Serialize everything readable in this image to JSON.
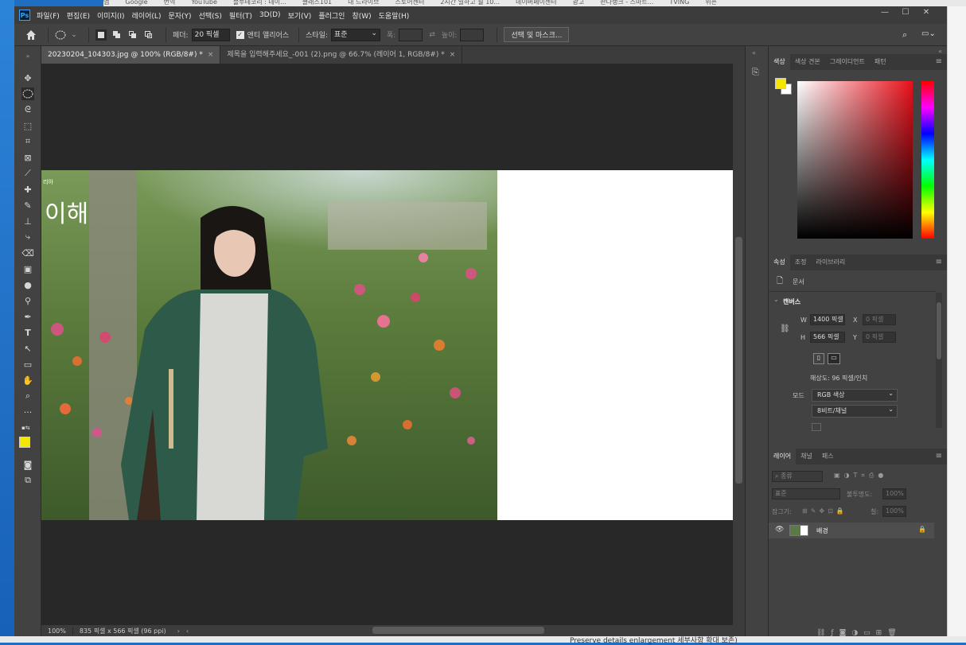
{
  "bookmarks": [
    "앱",
    "Google",
    "번역",
    "YouTube",
    "블루테코리 : 네이...",
    "클래스101",
    "내 드라이브",
    "스토어센터",
    "2시간 일하고 월 10...",
    "네이버페이센터",
    "광고",
    "판다랭크 - 스마트...",
    "TVING",
    "위픈"
  ],
  "menu": [
    "파일(F)",
    "편집(E)",
    "이미지(I)",
    "레이어(L)",
    "문자(Y)",
    "선택(S)",
    "필터(T)",
    "3D(D)",
    "보기(V)",
    "플러그인",
    "창(W)",
    "도움말(H)"
  ],
  "options": {
    "feather_label": "페더:",
    "feather_value": "20 픽셀",
    "antialias_label": "앤티 앨리어스",
    "style_label": "스타일:",
    "style_value": "표준",
    "width_label": "폭:",
    "height_label": "높이:",
    "mask_button": "선택 및 마스크..."
  },
  "tabs": [
    {
      "label": "20230204_104303.jpg @ 100% (RGB/8#) *"
    },
    {
      "label": "제목을 입력해주세요_-001 (2).png @ 66.7% (레이어 1, RGB/8#) *"
    }
  ],
  "photo": {
    "overlay_title": "이해",
    "overlay_small": "리아"
  },
  "status": {
    "zoom": "100%",
    "info": "835 픽셀 x 566 픽셀 (96 ppi)"
  },
  "color_panel": {
    "tabs": [
      "색상",
      "색상 견본",
      "그레이디언트",
      "패턴"
    ],
    "fg": "#f5e600",
    "bg": "#ffffff"
  },
  "props_panel": {
    "tabs": [
      "속성",
      "조정",
      "라이브러리"
    ],
    "doc_label": "문서",
    "canvas_label": "캔버스",
    "w_label": "W",
    "w_value": "1400 픽셀",
    "x_label": "X",
    "x_value": "0 픽셀",
    "h_label": "H",
    "h_value": "566 픽셀",
    "y_label": "Y",
    "y_value": "0 픽셀",
    "resolution": "해상도: 96 픽셀/인치",
    "mode_label": "모드",
    "mode_value": "RGB 색상",
    "depth_value": "8비트/채널"
  },
  "layers_panel": {
    "tabs": [
      "레이어",
      "채널",
      "패스"
    ],
    "filter_value": "종류",
    "blend_value": "표준",
    "opacity_label": "불투명도:",
    "opacity_value": "100%",
    "lock_label": "잠그기:",
    "fill_label": "칠:",
    "fill_value": "100%",
    "layer_name": "배경"
  },
  "footer_text": "Preserve details enlargement 세부사항 확대 보존)"
}
